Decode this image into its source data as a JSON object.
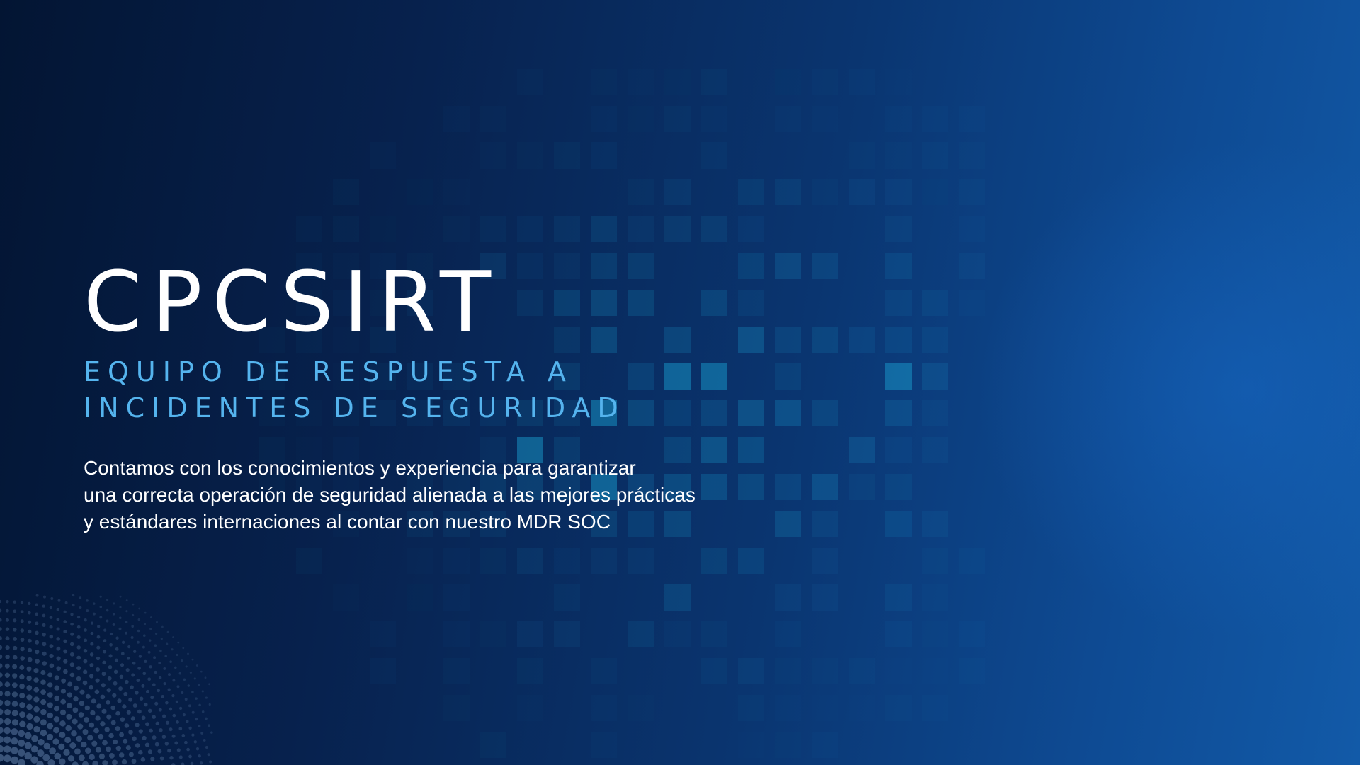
{
  "slide": {
    "title": "CPCSIRT",
    "subtitle_lines": [
      "EQUIPO DE RESPUESTA A",
      "INCIDENTES DE SEGURIDAD"
    ],
    "description_lines": [
      "Contamos con los conocimientos y experiencia para garantizar",
      "una correcta operación de seguridad alienada a las mejores prácticas",
      "y estándares internaciones al contar con nuestro MDR SOC"
    ]
  },
  "colors": {
    "background_dark": "#031533",
    "background_light": "#125aa8",
    "title": "#ffffff",
    "subtitle": "#55b4ee",
    "description": "#ffffff",
    "tile_accent": "#1aa6d8"
  }
}
